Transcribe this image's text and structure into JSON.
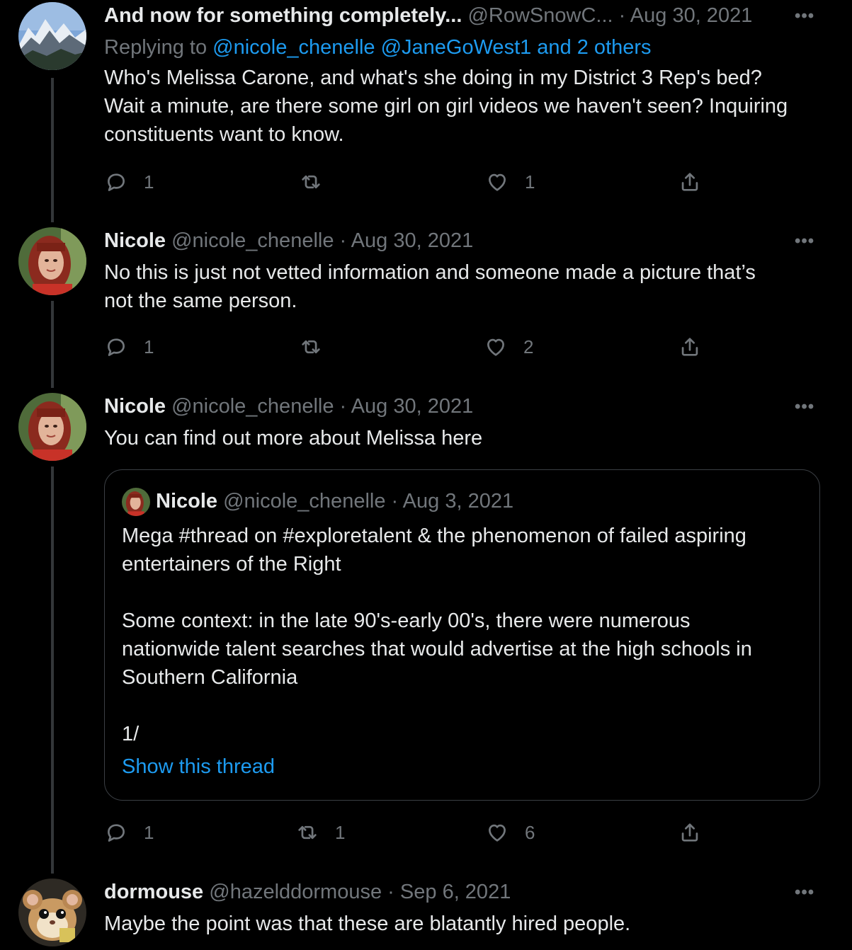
{
  "tweets": [
    {
      "name": "And now for something completely...",
      "handle": "@RowSnowC...",
      "dot": "·",
      "date": "Aug 30, 2021",
      "replying_prefix": "Replying to",
      "replying_to": "@nicole_chenelle @JaneGoWest1 and 2 others",
      "text_lines": [
        "Who's Melissa Carone, and what's she doing in my District 3 Rep's bed?",
        "Wait a minute, are there some girl on girl videos we haven't seen? Inquiring",
        "constituents want to know."
      ],
      "reply_count": "1",
      "retweet_count": "",
      "like_count": "1",
      "avatar_icon": "mountain-landscape-avatar"
    },
    {
      "name": "Nicole",
      "handle": "@nicole_chenelle",
      "dot": "·",
      "date": "Aug 30, 2021",
      "text_lines": [
        "No this is just not vetted information and someone made a picture that’s",
        "not the same person."
      ],
      "reply_count": "1",
      "retweet_count": "",
      "like_count": "2",
      "avatar_icon": "woman-portrait-avatar"
    },
    {
      "name": "Nicole",
      "handle": "@nicole_chenelle",
      "dot": "·",
      "date": "Aug 30, 2021",
      "text_lines": [
        "You can find out more about Melissa here"
      ],
      "reply_count": "1",
      "retweet_count": "1",
      "like_count": "6",
      "avatar_icon": "woman-portrait-avatar"
    },
    {
      "name": "dormouse",
      "handle": "@hazelddormouse",
      "dot": "·",
      "date": "Sep 6, 2021",
      "text_lines": [
        "Maybe the point was that these are blatantly hired people."
      ],
      "avatar_icon": "dormouse-avatar"
    }
  ],
  "quote": {
    "name": "Nicole",
    "handle": "@nicole_chenelle",
    "dot": "·",
    "date": "Aug 3, 2021",
    "text_lines": [
      "Mega #thread on #exploretalent & the phenomenon of failed aspiring",
      "entertainers of the Right",
      "Some context: in the late 90's-early 00's, there were numerous",
      "nationwide talent searches that would advertise at the high schools in",
      "Southern California",
      "1/"
    ],
    "show_thread": "Show this thread"
  },
  "more_label": "•••",
  "colors": {
    "background": "#000000",
    "text": "#e7e9ea",
    "secondary": "#71767b",
    "link": "#1d9bf0",
    "border": "#3b3f44"
  }
}
